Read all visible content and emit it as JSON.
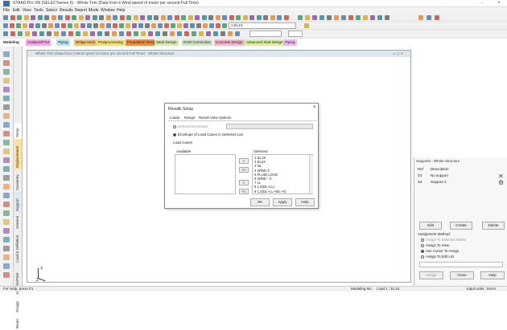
{
  "titlebar": {
    "title": "STAAD.Pro V8i (SELECTseries 6) - Whole Trim (Data from it Wind speed of motor per second Full Time)",
    "min": "-",
    "close": "×"
  },
  "menu": [
    "File",
    "Edit",
    "View",
    "Tools",
    "Select",
    "Results",
    "Report",
    "Mode",
    "Window",
    "Help"
  ],
  "toolbar": {
    "load_combo": "1 EL1X"
  },
  "module_tabs": [
    {
      "label": "Modeling",
      "color": "#ffffff"
    },
    {
      "label": "Analysis/Print",
      "color": "#f7a8e8"
    },
    {
      "label": "Piping",
      "color": "#b6e1f0"
    },
    {
      "label": "Bridge Deck",
      "color": "#f6c36e"
    },
    {
      "label": "Postprocessing",
      "color": "#f4de7a"
    },
    {
      "label": "Foundation Design",
      "color": "#f58a3c"
    },
    {
      "label": "Steel Design",
      "color": "#d7e8b5"
    },
    {
      "label": "RAM Connection",
      "color": "#cfe6c6"
    },
    {
      "label": "Concrete Design",
      "color": "#f5b5cc"
    },
    {
      "label": "Advanced Slab Design",
      "color": "#d8f0a4"
    },
    {
      "label": "Piping",
      "color": "#f1b9f2"
    }
  ],
  "vertical_tabs": [
    "Setup",
    "Displacement",
    "Geometry",
    "Support",
    "General",
    "Load & Definition",
    "Analysis/Print",
    "Design",
    "Beam",
    "Load"
  ],
  "work_window": {
    "title": "Whole Trim (Data from it Wind speed of motor per second Full Time) - Whole Structure",
    "axis_y": "Y",
    "axis_z": "Z"
  },
  "dialog": {
    "title": "Results Setup",
    "close": "×",
    "tabs": [
      "Loads",
      "Range",
      "Result View Options"
    ],
    "option_defined": "Defined Envelopes",
    "option_envelope": "Envelope of Load Cases in Selected List",
    "load_cases_label": "Load Cases",
    "available_label": "Available",
    "selected_label": "Selected",
    "selected_items": [
      "1 EL1X",
      "2 EL2X",
      "3 DL",
      "4 WIND X",
      "5 FLUID LOAD",
      "6 WIND - Z",
      "7 LL",
      "8 1.5(DL+LL)",
      "9 1.2(DL+LL+WL+X)"
    ],
    "ok": "OK",
    "apply": "Apply",
    "help": "Help"
  },
  "right_panel": {
    "title": "Supports - Whole Structure",
    "col_ref": "Ref",
    "col_desc": "Description",
    "rows": [
      {
        "ref": "S1",
        "desc": "No support"
      },
      {
        "ref": "S2",
        "desc": "Support 2"
      }
    ],
    "edit": "Edit",
    "create": "Create",
    "delete": "Delete",
    "assign_method": "Assignment Method",
    "methods": [
      "Assign To Selected Nodes",
      "Assign To View",
      "Use Cursor To Assign",
      "Assign To Edit List"
    ],
    "assign": "Assign",
    "close": "Close",
    "help": "Help"
  },
  "statusbar": {
    "left": "For Help, press F1",
    "mode": "Modeling Mo",
    "load": "Load 1 : EL1X",
    "units": "Input Units : kN-m"
  }
}
